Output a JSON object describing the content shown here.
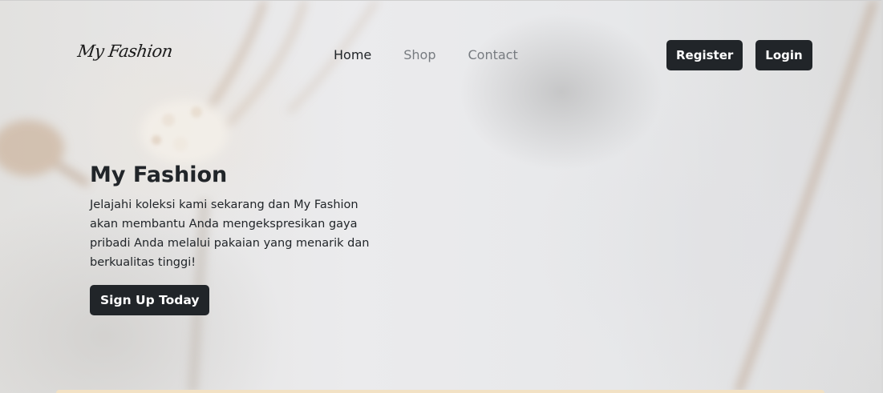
{
  "brand": {
    "name": "My Fashion"
  },
  "nav": {
    "links": [
      {
        "label": "Home",
        "active": true
      },
      {
        "label": "Shop",
        "active": false
      },
      {
        "label": "Contact",
        "active": false
      }
    ],
    "register_label": "Register",
    "login_label": "Login"
  },
  "hero": {
    "title": "My Fashion",
    "text": "Jelajahi koleksi kami sekarang dan My Fashion akan membantu Anda mengekspresikan gaya pribadi Anda melalui pakaian yang menarik dan berkualitas tinggi!",
    "cta_label": "Sign Up Today"
  },
  "colors": {
    "button_bg": "#212529",
    "button_text": "#ffffff",
    "nav_inactive": "#777b80",
    "text": "#212529",
    "strip": "#f2e1c4"
  }
}
